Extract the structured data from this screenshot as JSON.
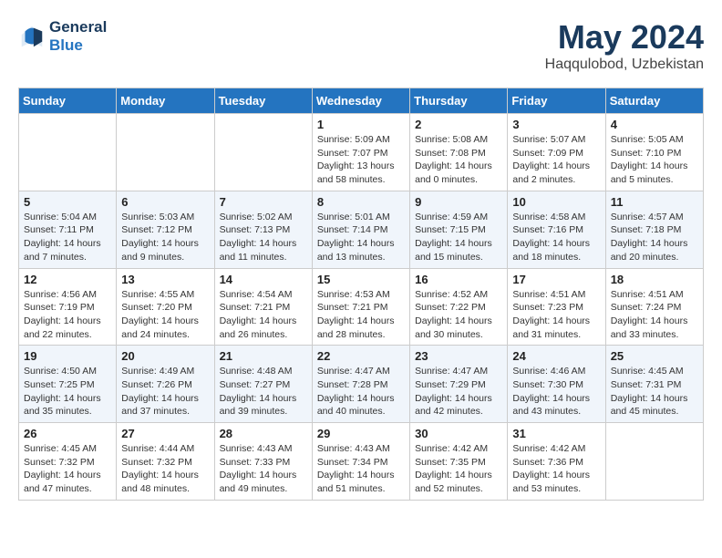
{
  "header": {
    "logo_line1": "General",
    "logo_line2": "Blue",
    "month": "May 2024",
    "location": "Haqqulobod, Uzbekistan"
  },
  "weekdays": [
    "Sunday",
    "Monday",
    "Tuesday",
    "Wednesday",
    "Thursday",
    "Friday",
    "Saturday"
  ],
  "weeks": [
    [
      {
        "day": "",
        "info": ""
      },
      {
        "day": "",
        "info": ""
      },
      {
        "day": "",
        "info": ""
      },
      {
        "day": "1",
        "info": "Sunrise: 5:09 AM\nSunset: 7:07 PM\nDaylight: 13 hours\nand 58 minutes."
      },
      {
        "day": "2",
        "info": "Sunrise: 5:08 AM\nSunset: 7:08 PM\nDaylight: 14 hours\nand 0 minutes."
      },
      {
        "day": "3",
        "info": "Sunrise: 5:07 AM\nSunset: 7:09 PM\nDaylight: 14 hours\nand 2 minutes."
      },
      {
        "day": "4",
        "info": "Sunrise: 5:05 AM\nSunset: 7:10 PM\nDaylight: 14 hours\nand 5 minutes."
      }
    ],
    [
      {
        "day": "5",
        "info": "Sunrise: 5:04 AM\nSunset: 7:11 PM\nDaylight: 14 hours\nand 7 minutes."
      },
      {
        "day": "6",
        "info": "Sunrise: 5:03 AM\nSunset: 7:12 PM\nDaylight: 14 hours\nand 9 minutes."
      },
      {
        "day": "7",
        "info": "Sunrise: 5:02 AM\nSunset: 7:13 PM\nDaylight: 14 hours\nand 11 minutes."
      },
      {
        "day": "8",
        "info": "Sunrise: 5:01 AM\nSunset: 7:14 PM\nDaylight: 14 hours\nand 13 minutes."
      },
      {
        "day": "9",
        "info": "Sunrise: 4:59 AM\nSunset: 7:15 PM\nDaylight: 14 hours\nand 15 minutes."
      },
      {
        "day": "10",
        "info": "Sunrise: 4:58 AM\nSunset: 7:16 PM\nDaylight: 14 hours\nand 18 minutes."
      },
      {
        "day": "11",
        "info": "Sunrise: 4:57 AM\nSunset: 7:18 PM\nDaylight: 14 hours\nand 20 minutes."
      }
    ],
    [
      {
        "day": "12",
        "info": "Sunrise: 4:56 AM\nSunset: 7:19 PM\nDaylight: 14 hours\nand 22 minutes."
      },
      {
        "day": "13",
        "info": "Sunrise: 4:55 AM\nSunset: 7:20 PM\nDaylight: 14 hours\nand 24 minutes."
      },
      {
        "day": "14",
        "info": "Sunrise: 4:54 AM\nSunset: 7:21 PM\nDaylight: 14 hours\nand 26 minutes."
      },
      {
        "day": "15",
        "info": "Sunrise: 4:53 AM\nSunset: 7:21 PM\nDaylight: 14 hours\nand 28 minutes."
      },
      {
        "day": "16",
        "info": "Sunrise: 4:52 AM\nSunset: 7:22 PM\nDaylight: 14 hours\nand 30 minutes."
      },
      {
        "day": "17",
        "info": "Sunrise: 4:51 AM\nSunset: 7:23 PM\nDaylight: 14 hours\nand 31 minutes."
      },
      {
        "day": "18",
        "info": "Sunrise: 4:51 AM\nSunset: 7:24 PM\nDaylight: 14 hours\nand 33 minutes."
      }
    ],
    [
      {
        "day": "19",
        "info": "Sunrise: 4:50 AM\nSunset: 7:25 PM\nDaylight: 14 hours\nand 35 minutes."
      },
      {
        "day": "20",
        "info": "Sunrise: 4:49 AM\nSunset: 7:26 PM\nDaylight: 14 hours\nand 37 minutes."
      },
      {
        "day": "21",
        "info": "Sunrise: 4:48 AM\nSunset: 7:27 PM\nDaylight: 14 hours\nand 39 minutes."
      },
      {
        "day": "22",
        "info": "Sunrise: 4:47 AM\nSunset: 7:28 PM\nDaylight: 14 hours\nand 40 minutes."
      },
      {
        "day": "23",
        "info": "Sunrise: 4:47 AM\nSunset: 7:29 PM\nDaylight: 14 hours\nand 42 minutes."
      },
      {
        "day": "24",
        "info": "Sunrise: 4:46 AM\nSunset: 7:30 PM\nDaylight: 14 hours\nand 43 minutes."
      },
      {
        "day": "25",
        "info": "Sunrise: 4:45 AM\nSunset: 7:31 PM\nDaylight: 14 hours\nand 45 minutes."
      }
    ],
    [
      {
        "day": "26",
        "info": "Sunrise: 4:45 AM\nSunset: 7:32 PM\nDaylight: 14 hours\nand 47 minutes."
      },
      {
        "day": "27",
        "info": "Sunrise: 4:44 AM\nSunset: 7:32 PM\nDaylight: 14 hours\nand 48 minutes."
      },
      {
        "day": "28",
        "info": "Sunrise: 4:43 AM\nSunset: 7:33 PM\nDaylight: 14 hours\nand 49 minutes."
      },
      {
        "day": "29",
        "info": "Sunrise: 4:43 AM\nSunset: 7:34 PM\nDaylight: 14 hours\nand 51 minutes."
      },
      {
        "day": "30",
        "info": "Sunrise: 4:42 AM\nSunset: 7:35 PM\nDaylight: 14 hours\nand 52 minutes."
      },
      {
        "day": "31",
        "info": "Sunrise: 4:42 AM\nSunset: 7:36 PM\nDaylight: 14 hours\nand 53 minutes."
      },
      {
        "day": "",
        "info": ""
      }
    ]
  ]
}
